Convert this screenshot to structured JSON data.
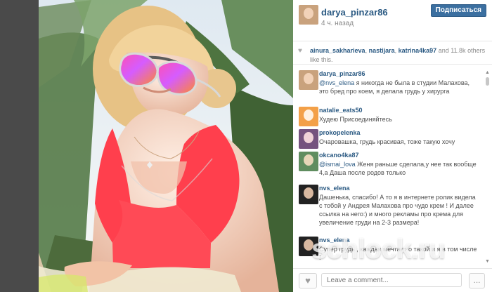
{
  "header": {
    "username": "darya_pinzar86",
    "time": "4 ч. назад",
    "location": "",
    "follow": "Подписаться"
  },
  "likes": {
    "users": [
      "ainura_sakharieva",
      "nastijara",
      "katrina4ka97"
    ],
    "and_others": "and 11.8k",
    "tail": "others like this."
  },
  "comments": [
    {
      "user": "darya_pinzar86",
      "mention": "@nvs_elena",
      "text": "я никогда не была в студии Малахова, это бред про коем, я делала грудь у хирурга"
    },
    {
      "user": "natalie_eats50",
      "mention": "",
      "text": "Худею Присоединяйтесь"
    },
    {
      "user": "prokopelenka",
      "mention": "",
      "text": "Очаровашка, грудь красивая, тоже такую хочу"
    },
    {
      "user": "okcano4ka87",
      "mention": "@ismai_lova",
      "text": "Женя раньше сделала,у нее так вообще 4,а Даша после родов только"
    },
    {
      "user": "nvs_elena",
      "mention": "",
      "text": "Дашенька, спасибо! А то я в интернете ролик видела с тобой у Андрея Малахова про чудо крем ! И далее ссылка на него:) и много рекламы про крема для увеличение груди на 2-3 размера!"
    },
    {
      "user": "nvs_elena",
      "mention": "",
      "text": "Супер грудь , каждая мечтает о такой и я в том числе !"
    }
  ],
  "footer": {
    "placeholder": "Leave a comment...",
    "more": "..."
  },
  "watermark": "schlock.ru"
}
